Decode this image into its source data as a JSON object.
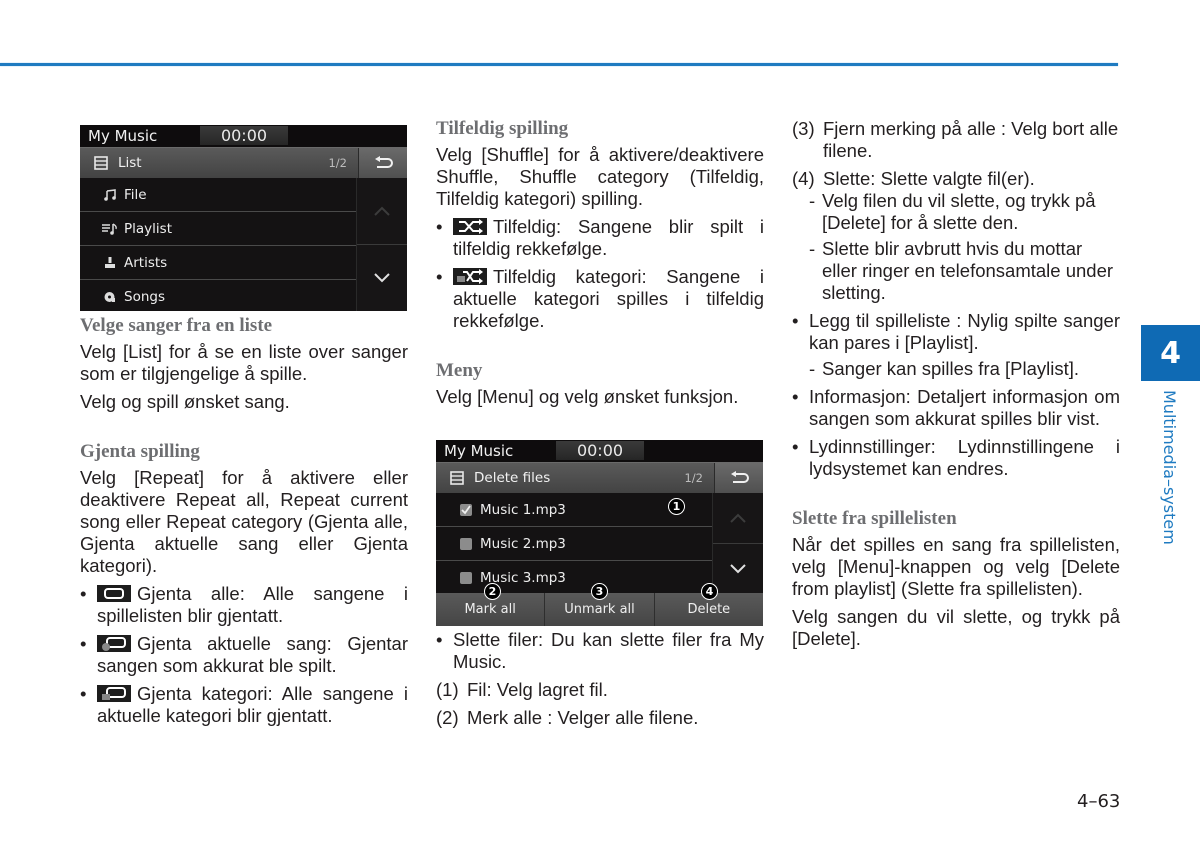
{
  "page": {
    "chapter_number": "4",
    "chapter_title": "Multimedia–system",
    "page_number": "4–63",
    "accent_color": "#1f7bc1",
    "tab_color": "#0f6ab4"
  },
  "screen1": {
    "app_title": "My Music",
    "clock": "00:00",
    "header_label": "List",
    "header_icon": "list-icon",
    "page_indicator": "1/2",
    "back_icon": "back-icon",
    "items": [
      {
        "label": "File",
        "icon": "music-note-icon"
      },
      {
        "label": "Playlist",
        "icon": "playlist-icon"
      },
      {
        "label": "Artists",
        "icon": "artist-icon"
      },
      {
        "label": "Songs",
        "icon": "songs-icon"
      }
    ],
    "scroll_up_icon": "chevron-up-icon",
    "scroll_down_icon": "chevron-down-icon"
  },
  "screen2": {
    "app_title": "My Music",
    "clock": "00:00",
    "header_label": "Delete files",
    "page_indicator": "1/2",
    "files": [
      {
        "label": "Music 1.mp3",
        "checked": true
      },
      {
        "label": "Music 2.mp3",
        "checked": false
      },
      {
        "label": "Music 3.mp3",
        "checked": false
      }
    ],
    "buttons": [
      "Mark all",
      "Unmark all",
      "Delete"
    ],
    "callouts": [
      "1",
      "2",
      "3",
      "4"
    ]
  },
  "col1": {
    "h_list": "Velge sanger fra en liste",
    "p_list1": "Velg [List] for å se en liste over sanger som er tilgjengelige å spille.",
    "p_list2": "Velg og spill ønsket sang.",
    "h_repeat": "Gjenta spilling",
    "p_repeat": "Velg [Repeat] for å aktivere eller deaktivere Repeat all, Repeat current song eller Repeat category (Gjenta alle, Gjenta aktuelle sang eller Gjenta kategori).",
    "repeat_bullets": [
      {
        "icon": "repeat-all-icon",
        "text": "Gjenta alle: Alle sangene i spillelisten blir gjentatt."
      },
      {
        "icon": "repeat-one-icon",
        "text": "Gjenta aktuelle sang: Gjentar sangen som akkurat ble spilt."
      },
      {
        "icon": "repeat-category-icon",
        "text": "Gjenta kategori: Alle sangene i aktuelle kategori blir gjentatt."
      }
    ]
  },
  "col2": {
    "h_shuffle": "Tilfeldig spilling",
    "p_shuffle": "Velg [Shuffle] for å aktivere/deaktivere Shuffle, Shuffle category (Tilfeldig, Tilfeldig kategori) spilling.",
    "shuffle_bullets": [
      {
        "icon": "shuffle-icon",
        "text": "Tilfeldig: Sangene blir spilt i tilfeldig rekkefølge."
      },
      {
        "icon": "shuffle-category-icon",
        "text": "Tilfeldig kategori: Sangene i aktuelle kategori spilles i tilfeldig rekkefølge."
      }
    ],
    "h_menu": "Meny",
    "p_menu": "Velg [Menu] og velg ønsket funksjon.",
    "b_delete": "Slette filer: Du kan slette filer fra My Music.",
    "n1_num": "(1)",
    "n1_text": "Fil: Velg lagret fil.",
    "n2_num": "(2)",
    "n2_text": "Merk alle : Velger alle filene."
  },
  "col3": {
    "n3_num": "(3)",
    "n3_text": "Fjern merking på alle : Velg bort alle filene.",
    "n4_num": "(4)",
    "n4_text": "Slette: Slette valgte fil(er).",
    "dash1": "Velg filen du vil slette, og trykk på [Delete] for å slette den.",
    "dash2": "Slette blir avbrutt hvis du mottar eller ringer en telefonsamtale under sletting.",
    "b_playlist": "Legg til spilleliste : Nylig spilte sanger kan pares i [Playlist].",
    "dash3": "Sanger kan spilles fra [Playlist].",
    "b_info": "Informasjon: Detaljert informasjon om sangen som akkurat spilles blir vist.",
    "b_sound": "Lydinnstillinger: Lydinnstillingene i lydsystemet kan endres.",
    "h_delete_pl": "Slette fra spillelisten",
    "p_delete_pl1": "Når det spilles en sang fra spillelisten, velg [Menu]-knappen og velg [Delete from playlist] (Slette fra spillelisten).",
    "p_delete_pl2": "Velg sangen du vil slette, og trykk på [Delete]."
  }
}
